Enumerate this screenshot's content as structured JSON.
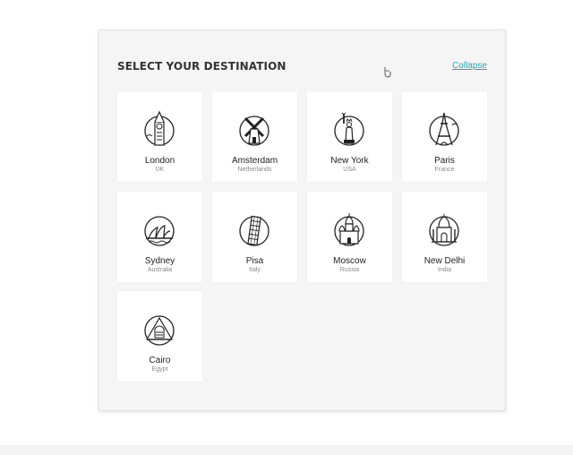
{
  "panel": {
    "title": "SELECT YOUR DESTINATION",
    "collapse_label": "Collapse"
  },
  "destinations": [
    {
      "city": "London",
      "country": "UK",
      "icon": "big-ben-icon"
    },
    {
      "city": "Amsterdam",
      "country": "Netherlands",
      "icon": "windmill-icon"
    },
    {
      "city": "New York",
      "country": "USA",
      "icon": "statue-of-liberty-icon"
    },
    {
      "city": "Paris",
      "country": "France",
      "icon": "eiffel-tower-icon"
    },
    {
      "city": "Sydney",
      "country": "Australia",
      "icon": "opera-house-icon"
    },
    {
      "city": "Pisa",
      "country": "Italy",
      "icon": "leaning-tower-icon"
    },
    {
      "city": "Moscow",
      "country": "Russia",
      "icon": "kremlin-icon"
    },
    {
      "city": "New Delhi",
      "country": "India",
      "icon": "taj-mahal-icon"
    },
    {
      "city": "Cairo",
      "country": "Egypt",
      "icon": "pyramid-icon"
    }
  ]
}
